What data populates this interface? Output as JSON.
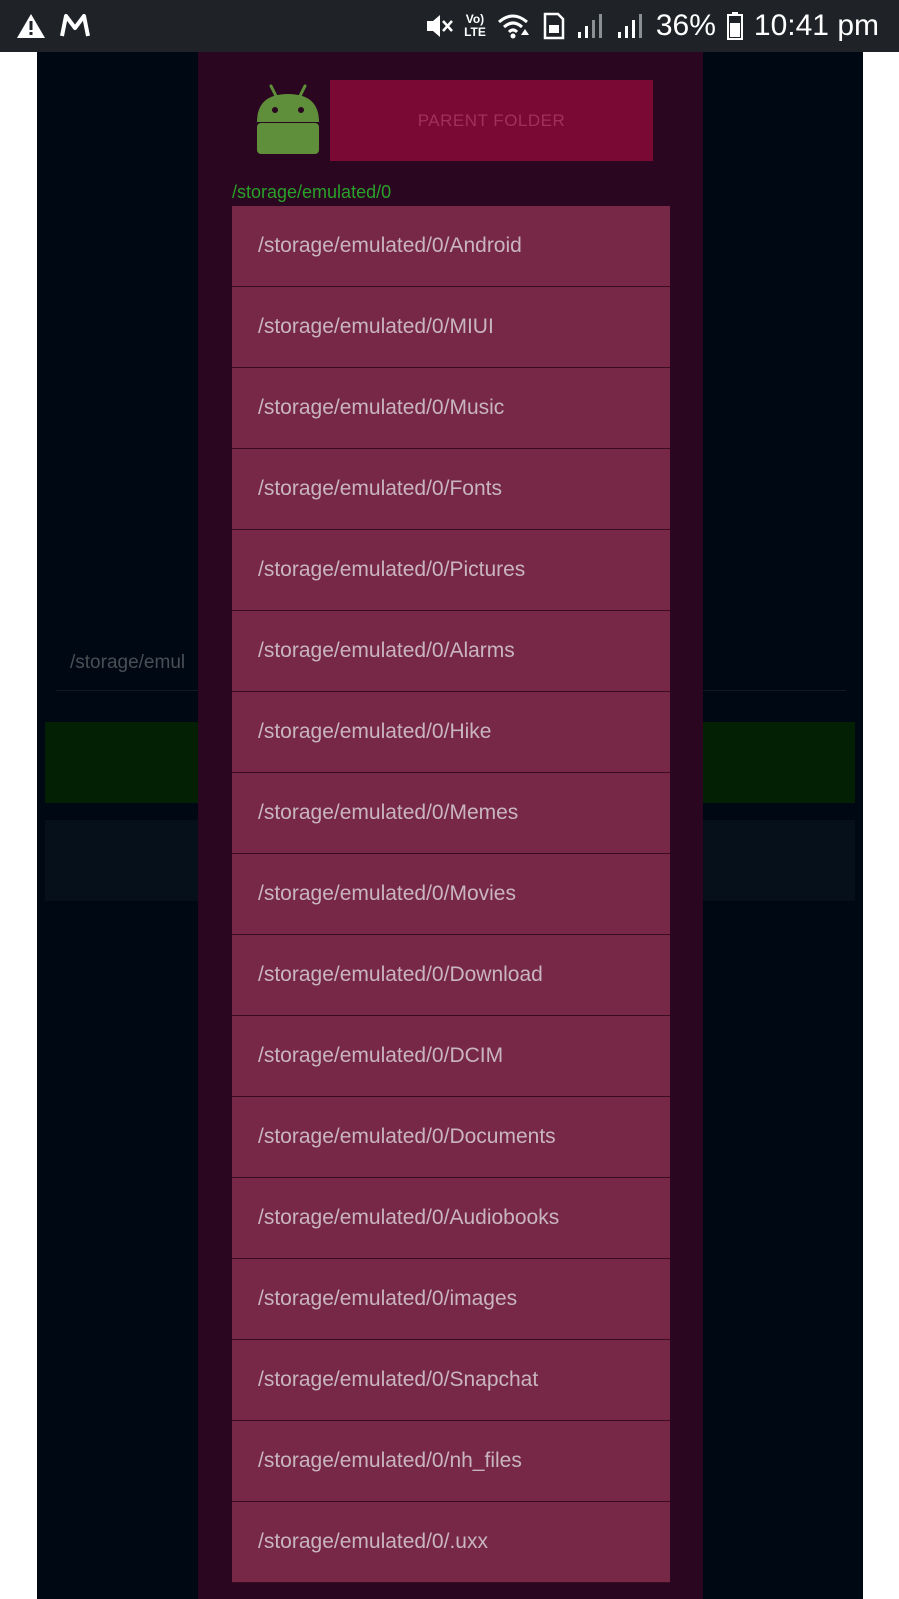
{
  "status_bar": {
    "battery": "36%",
    "time": "10:41 pm",
    "volte_top": "Vo)",
    "volte_bottom": "LTE",
    "icons": [
      "alert-icon",
      "gmail-icon",
      "mute-icon",
      "volte-icon",
      "wifi-icon",
      "sim-icon",
      "signal-icon",
      "signal-icon",
      "battery-icon"
    ]
  },
  "background": {
    "path_text": "/storage/emul"
  },
  "dialog": {
    "logo": "android-icon",
    "parent_button_label": "PARENT FOLDER",
    "current_path": "/storage/emulated/0",
    "folders": [
      "/storage/emulated/0/Android",
      "/storage/emulated/0/MIUI",
      "/storage/emulated/0/Music",
      "/storage/emulated/0/Fonts",
      "/storage/emulated/0/Pictures",
      "/storage/emulated/0/Alarms",
      "/storage/emulated/0/Hike",
      "/storage/emulated/0/Memes",
      "/storage/emulated/0/Movies",
      "/storage/emulated/0/Download",
      "/storage/emulated/0/DCIM",
      "/storage/emulated/0/Documents",
      "/storage/emulated/0/Audiobooks",
      "/storage/emulated/0/images",
      "/storage/emulated/0/Snapchat",
      "/storage/emulated/0/nh_files",
      "/storage/emulated/0/.uxx"
    ]
  },
  "colors": {
    "status_bar": "#1f2328",
    "app_background": "#000814",
    "dialog_background": "#2a0620",
    "parent_button": "#7a0a34",
    "folder_item": "#772846",
    "path_green": "#2aa12a"
  }
}
